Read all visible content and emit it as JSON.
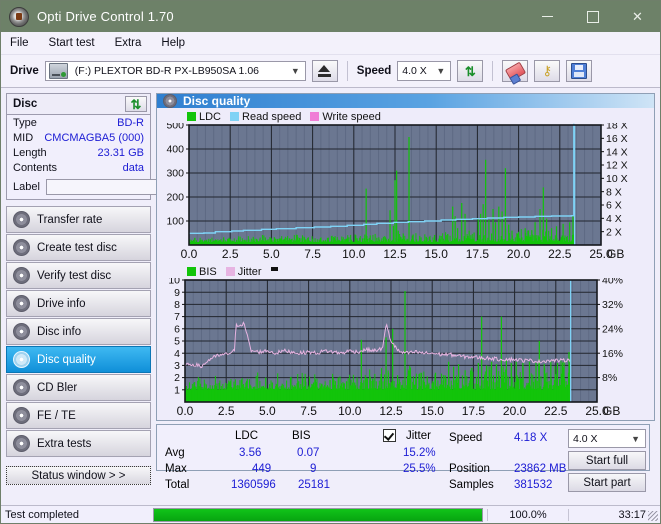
{
  "window": {
    "title": "Opti Drive Control 1.70",
    "icon": "disc-icon",
    "minimize": "–",
    "maximize": "□",
    "close": "✕"
  },
  "menu": {
    "items": [
      "File",
      "Start test",
      "Extra",
      "Help"
    ]
  },
  "toolbar": {
    "drive_label": "Drive",
    "drive_value": "(F:)   PLEXTOR BD-R  PX-LB950SA 1.06",
    "eject_title": "Eject",
    "speed_label": "Speed",
    "speed_value": "4.0 X",
    "refresh_title": "Refresh",
    "erase_title": "Erase",
    "keys_title": "Keys",
    "save_title": "Save"
  },
  "disc_panel": {
    "title": "Disc",
    "refresh_icon": "refresh-icon",
    "rows": [
      {
        "key": "Type",
        "value": "BD-R"
      },
      {
        "key": "MID",
        "value": "CMCMAGBA5 (000)"
      },
      {
        "key": "Length",
        "value": "23.31 GB"
      },
      {
        "key": "Contents",
        "value": "data"
      }
    ],
    "label_key": "Label",
    "label_value": "",
    "label_placeholder": ""
  },
  "nav": {
    "items": [
      {
        "label": "Transfer rate",
        "active": false
      },
      {
        "label": "Create test disc",
        "active": false
      },
      {
        "label": "Verify test disc",
        "active": false
      },
      {
        "label": "Drive info",
        "active": false
      },
      {
        "label": "Disc info",
        "active": false
      },
      {
        "label": "Disc quality",
        "active": true
      },
      {
        "label": "CD Bler",
        "active": false
      },
      {
        "label": "FE / TE",
        "active": false
      },
      {
        "label": "Extra tests",
        "active": false
      }
    ],
    "status_window": "Status window > >"
  },
  "content": {
    "header": "Disc quality"
  },
  "stats": {
    "col_ldc": "LDC",
    "col_bis": "BIS",
    "jitter_label": "Jitter",
    "jitter_checked": true,
    "row_avg": "Avg",
    "row_max": "Max",
    "row_total": "Total",
    "avg_ldc": "3.56",
    "avg_bis": "0.07",
    "avg_jitter": "15.2%",
    "max_ldc": "449",
    "max_bis": "9",
    "max_jitter": "25.5%",
    "total_ldc": "1360596",
    "total_bis": "25181",
    "speed_label": "Speed",
    "speed_value": "4.18 X",
    "position_label": "Position",
    "position_value": "23862 MB",
    "samples_label": "Samples",
    "samples_value": "381532",
    "speed_select": "4.0 X",
    "start_full": "Start full",
    "start_part": "Start part"
  },
  "statusbar": {
    "text": "Test completed",
    "progress_percent": 100,
    "percent_label": "100.0%",
    "time": "33:17"
  },
  "colors": {
    "ldc_green": "#12c40a",
    "read_speed": "#7fd2f5",
    "write_speed": "#f07ed6",
    "bis_green": "#12c40a",
    "jitter_pink": "#e7b4e2",
    "plot_bg": "#6b7791",
    "accent": "#1c1cd4"
  },
  "chart_data": [
    {
      "type": "area",
      "name": "top-chart",
      "title": "",
      "xlabel": "GB",
      "ylabel": "",
      "xlim": [
        0,
        25.0
      ],
      "ylim": [
        0,
        500
      ],
      "y2lim": [
        0,
        18
      ],
      "xticks": [
        "0.0",
        "2.5",
        "5.0",
        "7.5",
        "10.0",
        "12.5",
        "15.0",
        "17.5",
        "20.0",
        "22.5",
        "25.0"
      ],
      "yticks": [
        "100",
        "200",
        "300",
        "400",
        "500"
      ],
      "y2ticks": [
        "2 X",
        "4 X",
        "6 X",
        "8 X",
        "10 X",
        "12 X",
        "14 X",
        "16 X",
        "18 X"
      ],
      "grid": true,
      "legend": [
        {
          "label": "LDC",
          "color": "#12c40a"
        },
        {
          "label": "Read speed",
          "color": "#7fd2f5"
        },
        {
          "label": "Write speed",
          "color": "#f07ed6"
        }
      ],
      "data_end_gb": 23.4,
      "series": [
        {
          "name": "LDC",
          "type": "impulse",
          "color": "#12c40a",
          "baseline": 12,
          "spikes": [
            [
              0.35,
              30
            ],
            [
              0.8,
              22
            ],
            [
              1.2,
              26
            ],
            [
              1.6,
              20
            ],
            [
              2.1,
              32
            ],
            [
              2.5,
              24
            ],
            [
              3.0,
              28
            ],
            [
              3.4,
              22
            ],
            [
              3.9,
              34
            ],
            [
              4.3,
              26
            ],
            [
              4.8,
              24
            ],
            [
              5.2,
              30
            ],
            [
              5.7,
              22
            ],
            [
              6.1,
              28
            ],
            [
              6.6,
              24
            ],
            [
              7.0,
              32
            ],
            [
              7.5,
              26
            ],
            [
              7.9,
              22
            ],
            [
              8.4,
              30
            ],
            [
              8.8,
              26
            ],
            [
              9.3,
              24
            ],
            [
              9.7,
              32
            ],
            [
              10.2,
              28
            ],
            [
              10.75,
              235
            ],
            [
              11.0,
              40
            ],
            [
              11.4,
              30
            ],
            [
              11.8,
              34
            ],
            [
              12.2,
              145
            ],
            [
              12.4,
              80
            ],
            [
              12.5,
              270
            ],
            [
              12.6,
              310
            ],
            [
              12.7,
              60
            ],
            [
              13.0,
              48
            ],
            [
              13.35,
              450
            ],
            [
              13.6,
              44
            ],
            [
              14.0,
              38
            ],
            [
              14.4,
              34
            ],
            [
              14.9,
              42
            ],
            [
              15.3,
              38
            ],
            [
              15.7,
              46
            ],
            [
              16.0,
              160
            ],
            [
              16.15,
              120
            ],
            [
              16.3,
              70
            ],
            [
              16.55,
              175
            ],
            [
              16.75,
              130
            ],
            [
              17.0,
              60
            ],
            [
              17.3,
              52
            ],
            [
              17.55,
              110
            ],
            [
              17.7,
              130
            ],
            [
              17.85,
              170
            ],
            [
              18.0,
              355
            ],
            [
              18.2,
              105
            ],
            [
              18.45,
              150
            ],
            [
              18.6,
              95
            ],
            [
              18.8,
              160
            ],
            [
              19.0,
              140
            ],
            [
              19.2,
              320
            ],
            [
              19.4,
              85
            ],
            [
              19.6,
              60
            ],
            [
              20.0,
              55
            ],
            [
              20.4,
              70
            ],
            [
              20.8,
              62
            ],
            [
              21.0,
              95
            ],
            [
              21.3,
              150
            ],
            [
              21.5,
              240
            ],
            [
              21.7,
              110
            ],
            [
              22.0,
              70
            ],
            [
              22.3,
              78
            ],
            [
              22.7,
              88
            ],
            [
              23.1,
              95
            ],
            [
              23.3,
              120
            ]
          ]
        },
        {
          "name": "Read speed",
          "type": "step-line",
          "color": "#7fd2f5",
          "axis": "right",
          "points": [
            [
              0.0,
              1.75
            ],
            [
              0.9,
              1.8
            ],
            [
              1.6,
              2.0
            ],
            [
              2.6,
              2.1
            ],
            [
              3.3,
              2.2
            ],
            [
              4.4,
              2.35
            ],
            [
              5.3,
              2.45
            ],
            [
              6.5,
              2.6
            ],
            [
              7.6,
              2.7
            ],
            [
              8.6,
              2.8
            ],
            [
              9.6,
              2.95
            ],
            [
              10.6,
              3.1
            ],
            [
              11.4,
              3.25
            ],
            [
              12.4,
              3.4
            ],
            [
              13.3,
              3.5
            ],
            [
              14.3,
              3.6
            ],
            [
              15.3,
              3.75
            ],
            [
              16.2,
              3.85
            ],
            [
              17.2,
              3.95
            ],
            [
              18.1,
              4.05
            ],
            [
              19.1,
              4.15
            ],
            [
              20.0,
              4.2
            ],
            [
              21.0,
              4.3
            ],
            [
              22.0,
              4.35
            ],
            [
              23.2,
              4.4
            ],
            [
              23.35,
              18.2
            ]
          ]
        }
      ]
    },
    {
      "type": "area",
      "name": "bottom-chart",
      "title": "",
      "xlabel": "GB",
      "ylabel": "",
      "xlim": [
        0,
        25.0
      ],
      "ylim": [
        0,
        10
      ],
      "y2lim": [
        0,
        40
      ],
      "xticks": [
        "0.0",
        "2.5",
        "5.0",
        "7.5",
        "10.0",
        "12.5",
        "15.0",
        "17.5",
        "20.0",
        "22.5",
        "25.0"
      ],
      "yticks": [
        "1",
        "2",
        "3",
        "4",
        "5",
        "6",
        "7",
        "8",
        "9",
        "10"
      ],
      "y2ticks": [
        "8%",
        "16%",
        "24%",
        "32%",
        "40%"
      ],
      "grid": true,
      "legend": [
        {
          "label": "BIS",
          "color": "#12c40a"
        },
        {
          "label": "Jitter",
          "color": "#e7b4e2"
        }
      ],
      "data_end_gb": 23.4,
      "series": [
        {
          "name": "BIS",
          "type": "impulse",
          "color": "#12c40a",
          "baseline": 1,
          "spikes": [
            [
              0.6,
              1.3
            ],
            [
              1.2,
              1.4
            ],
            [
              1.9,
              1.3
            ],
            [
              2.6,
              1.5
            ],
            [
              3.2,
              1.4
            ],
            [
              4.0,
              1.3
            ],
            [
              4.9,
              2.0
            ],
            [
              5.3,
              1.6
            ],
            [
              5.9,
              1.5
            ],
            [
              6.4,
              2.0
            ],
            [
              6.9,
              1.7
            ],
            [
              7.3,
              2.0
            ],
            [
              7.8,
              1.6
            ],
            [
              8.3,
              1.5
            ],
            [
              8.8,
              1.8
            ],
            [
              9.3,
              2.0
            ],
            [
              9.8,
              1.7
            ],
            [
              10.3,
              1.6
            ],
            [
              10.7,
              5.1
            ],
            [
              11.0,
              2.0
            ],
            [
              11.4,
              1.9
            ],
            [
              11.9,
              2.3
            ],
            [
              12.2,
              5.3
            ],
            [
              12.35,
              2.4
            ],
            [
              12.6,
              6.0
            ],
            [
              12.9,
              2.2
            ],
            [
              13.35,
              9.1
            ],
            [
              13.7,
              2.1
            ],
            [
              14.2,
              2.3
            ],
            [
              14.7,
              2.1
            ],
            [
              15.2,
              2.4
            ],
            [
              15.7,
              2.2
            ],
            [
              16.0,
              3.3
            ],
            [
              16.3,
              2.9
            ],
            [
              16.6,
              3.1
            ],
            [
              17.0,
              2.6
            ],
            [
              17.4,
              2.8
            ],
            [
              17.8,
              3.2
            ],
            [
              18.0,
              7.0
            ],
            [
              18.3,
              3.0
            ],
            [
              18.6,
              3.3
            ],
            [
              18.9,
              3.1
            ],
            [
              19.2,
              7.0
            ],
            [
              19.5,
              3.4
            ],
            [
              19.8,
              3.2
            ],
            [
              20.1,
              3.3
            ],
            [
              20.5,
              3.2
            ],
            [
              20.9,
              3.3
            ],
            [
              21.3,
              3.2
            ],
            [
              21.5,
              5.0
            ],
            [
              21.8,
              3.1
            ],
            [
              22.2,
              3.3
            ],
            [
              22.6,
              3.2
            ],
            [
              23.0,
              3.3
            ],
            [
              23.3,
              4.1
            ]
          ]
        },
        {
          "name": "Jitter",
          "type": "line",
          "color": "#e7b4e2",
          "axis": "right",
          "noise": 0.3,
          "points": [
            [
              0.0,
              3.0
            ],
            [
              0.5,
              3.1
            ],
            [
              1.0,
              2.9
            ],
            [
              1.5,
              3.5
            ],
            [
              2.0,
              3.8
            ],
            [
              2.5,
              3.9
            ],
            [
              3.0,
              4.2
            ],
            [
              3.1,
              6.3
            ],
            [
              3.6,
              6.4
            ],
            [
              4.0,
              4.2
            ],
            [
              4.5,
              4.1
            ],
            [
              5.0,
              4.2
            ],
            [
              5.5,
              4.0
            ],
            [
              6.0,
              4.2
            ],
            [
              6.5,
              4.1
            ],
            [
              7.0,
              4.0
            ],
            [
              7.5,
              4.1
            ],
            [
              8.0,
              4.0
            ],
            [
              8.5,
              4.2
            ],
            [
              9.0,
              4.1
            ],
            [
              9.5,
              4.0
            ],
            [
              10.0,
              4.2
            ],
            [
              10.5,
              4.1
            ],
            [
              11.0,
              4.3
            ],
            [
              11.5,
              4.2
            ],
            [
              12.0,
              4.4
            ],
            [
              12.2,
              6.4
            ],
            [
              12.5,
              5.0
            ],
            [
              13.0,
              4.1
            ],
            [
              13.5,
              4.0
            ],
            [
              14.0,
              4.1
            ],
            [
              14.5,
              4.0
            ],
            [
              15.0,
              4.0
            ],
            [
              15.5,
              3.9
            ],
            [
              16.0,
              3.9
            ],
            [
              16.5,
              3.8
            ],
            [
              17.0,
              3.7
            ],
            [
              17.5,
              3.7
            ],
            [
              18.0,
              3.6
            ],
            [
              18.5,
              3.6
            ],
            [
              19.0,
              3.5
            ],
            [
              19.5,
              3.5
            ],
            [
              20.0,
              3.5
            ],
            [
              20.5,
              3.4
            ],
            [
              21.0,
              3.4
            ],
            [
              21.5,
              3.3
            ],
            [
              22.0,
              3.4
            ],
            [
              22.5,
              3.4
            ],
            [
              23.0,
              3.4
            ],
            [
              23.35,
              3.5
            ]
          ]
        }
      ]
    }
  ]
}
